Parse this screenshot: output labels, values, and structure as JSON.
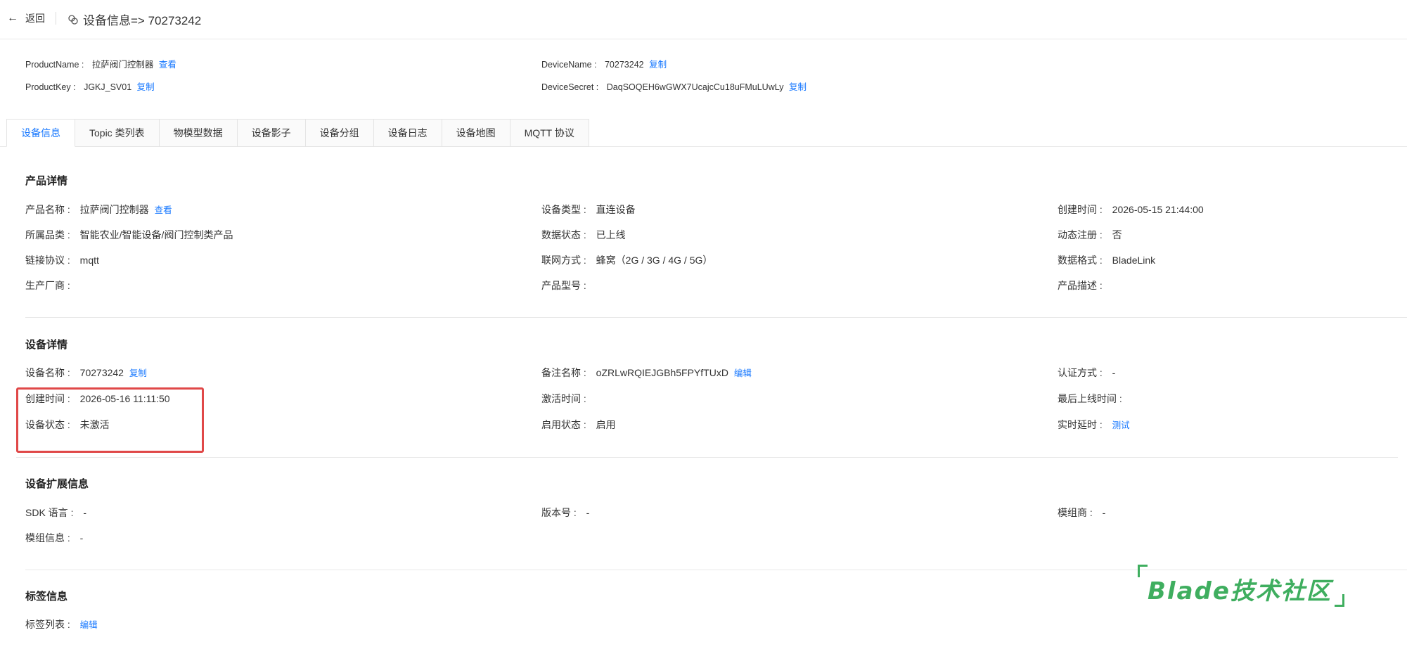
{
  "header": {
    "back_label": "返回",
    "title": "设备信息=> 70273242"
  },
  "summary": {
    "product_name_label": "ProductName :",
    "product_name_value": "拉萨阀门控制器",
    "product_name_link": "查看",
    "product_key_label": "ProductKey :",
    "product_key_value": "JGKJ_SV01",
    "product_key_link": "复制",
    "device_name_label": "DeviceName :",
    "device_name_value": "70273242",
    "device_name_link": "复制",
    "device_secret_label": "DeviceSecret :",
    "device_secret_value": "DaqSOQEH6wGWX7UcajcCu18uFMuLUwLy",
    "device_secret_link": "复制"
  },
  "tabs": [
    "设备信息",
    "Topic 类列表",
    "物模型数据",
    "设备影子",
    "设备分组",
    "设备日志",
    "设备地图",
    "MQTT 协议"
  ],
  "product_detail": {
    "title": "产品详情",
    "product_name_label": "产品名称 :",
    "product_name_value": "拉萨阀门控制器",
    "product_name_link": "查看",
    "device_type_label": "设备类型 :",
    "device_type_value": "直连设备",
    "created_label": "创建时间 :",
    "created_value": "2026-05-15 21:44:00",
    "category_label": "所属品类 :",
    "category_value": "智能农业/智能设备/阀门控制类产品",
    "data_status_label": "数据状态 :",
    "data_status_value": "已上线",
    "dynamic_reg_label": "动态注册 :",
    "dynamic_reg_value": "否",
    "protocol_label": "链接协议 :",
    "protocol_value": "mqtt",
    "network_label": "联网方式 :",
    "network_value": "蜂窝（2G / 3G / 4G / 5G）",
    "data_format_label": "数据格式 :",
    "data_format_value": "BladeLink",
    "manufacturer_label": "生产厂商 :",
    "model_label": "产品型号 :",
    "description_label": "产品描述 :"
  },
  "device_detail": {
    "title": "设备详情",
    "device_name_label": "设备名称 :",
    "device_name_value": "70273242",
    "device_name_link": "复制",
    "remark_label": "备注名称 :",
    "remark_value": "oZRLwRQIEJGBh5FPYfTUxD",
    "remark_link": "编辑",
    "auth_label": "认证方式 :",
    "auth_value": "-",
    "created_label": "创建时间 :",
    "created_value": "2026-05-16 11:11:50",
    "activated_label": "激活时间 :",
    "last_online_label": "最后上线时间 :",
    "status_label": "设备状态 :",
    "status_value": "未激活",
    "enabled_label": "启用状态 :",
    "enabled_value": "启用",
    "latency_label": "实时延时 :",
    "latency_link": "测试"
  },
  "extension": {
    "title": "设备扩展信息",
    "sdk_label": "SDK 语言 :",
    "sdk_value": "-",
    "version_label": "版本号 :",
    "version_value": "-",
    "module_vendor_label": "模组商 :",
    "module_vendor_value": "-",
    "module_info_label": "模组信息 :",
    "module_info_value": "-"
  },
  "tags": {
    "title": "标签信息",
    "list_label": "标签列表 :",
    "list_link": "编辑"
  },
  "watermark": {
    "text": "Blade技术社区"
  },
  "colors": {
    "accent": "#1677ff",
    "highlight_box": "#e04848",
    "watermark": "#3fae5f"
  }
}
